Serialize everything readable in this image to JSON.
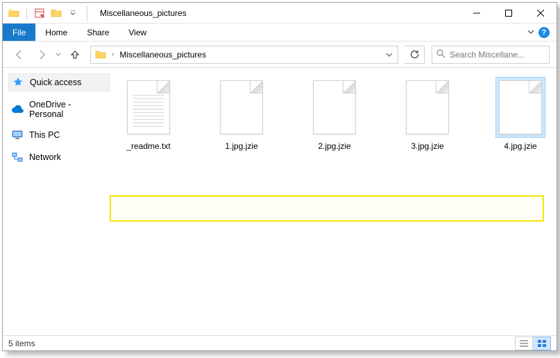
{
  "title": "Miscellaneous_pictures",
  "ribbon": {
    "file": "File",
    "tabs": [
      "Home",
      "Share",
      "View"
    ]
  },
  "address": {
    "current": "Miscellaneous_pictures"
  },
  "search": {
    "placeholder": "Search Miscellane..."
  },
  "sidebar": {
    "items": [
      {
        "label": "Quick access"
      },
      {
        "label": "OneDrive - Personal"
      },
      {
        "label": "This PC"
      },
      {
        "label": "Network"
      }
    ]
  },
  "files": [
    {
      "name": "_readme.txt",
      "kind": "text",
      "selected": false
    },
    {
      "name": "1.jpg.jzie",
      "kind": "blank",
      "selected": false
    },
    {
      "name": "2.jpg.jzie",
      "kind": "blank",
      "selected": false
    },
    {
      "name": "3.jpg.jzie",
      "kind": "blank",
      "selected": false
    },
    {
      "name": "4.jpg.jzie",
      "kind": "blank",
      "selected": true
    }
  ],
  "status": {
    "count_label": "5 items"
  }
}
